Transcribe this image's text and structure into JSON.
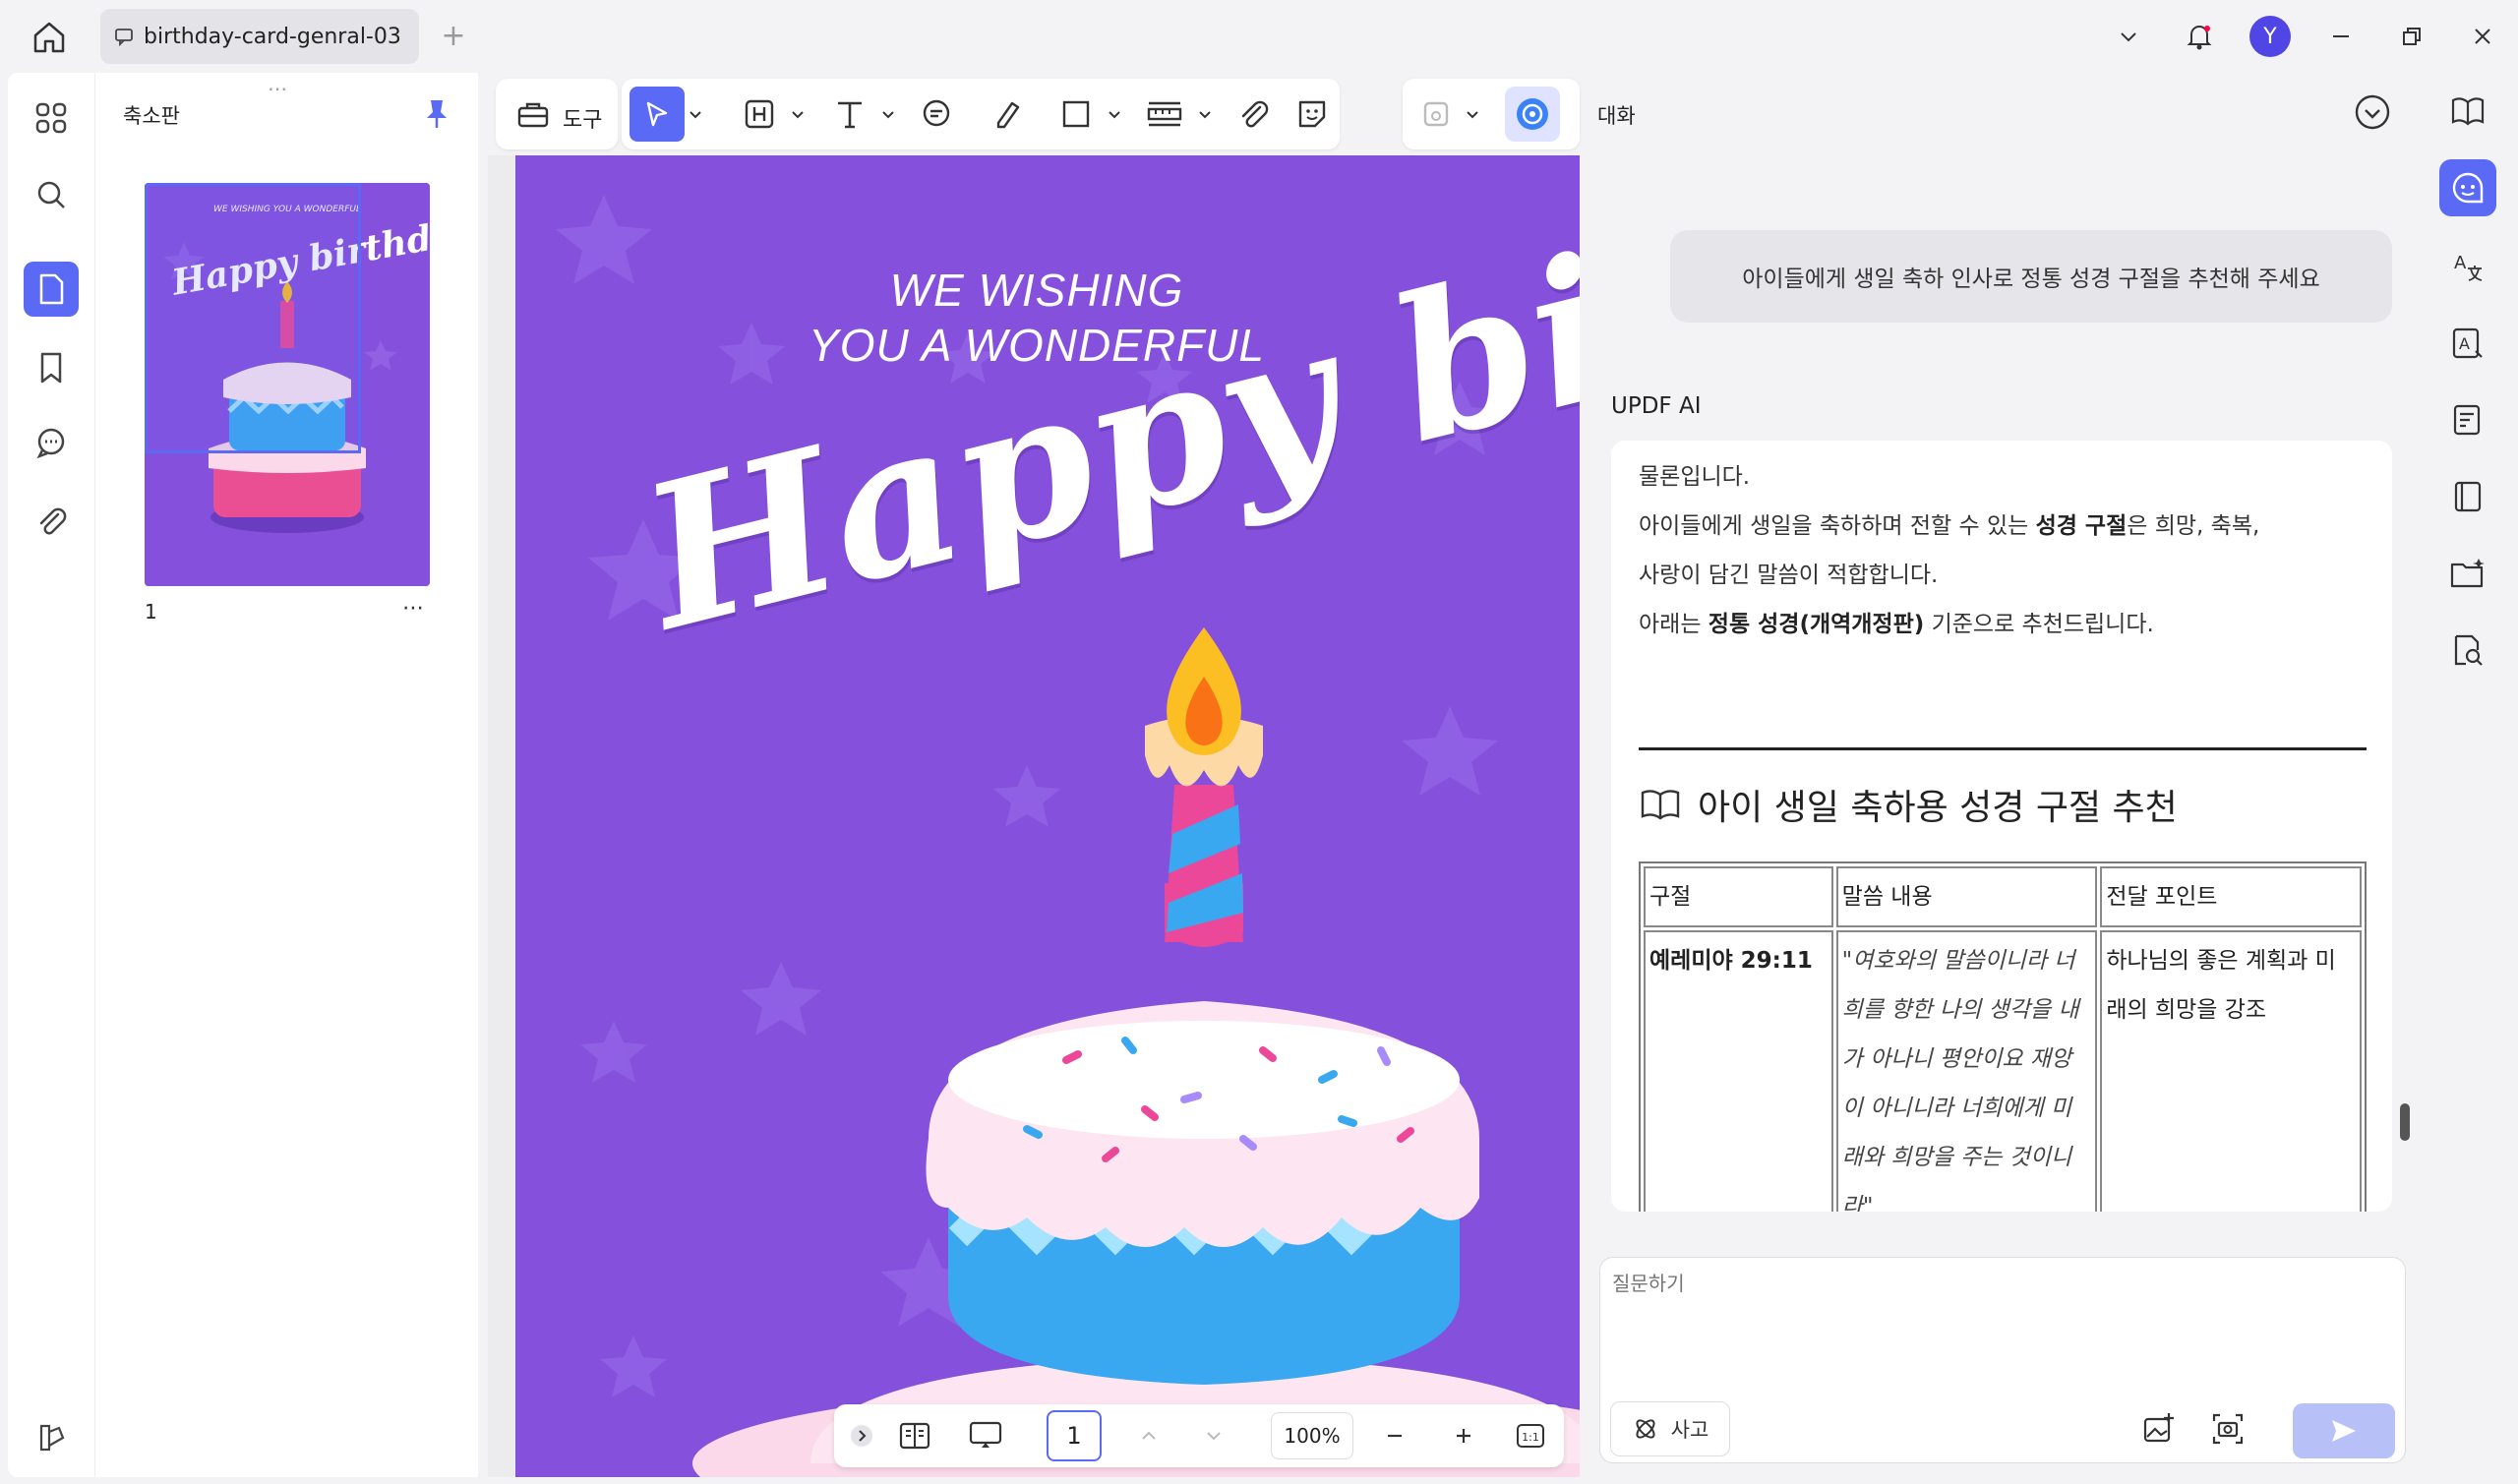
{
  "tab": {
    "title": "birthday-card-genral-03"
  },
  "titlebar": {
    "avatar_letter": "Y"
  },
  "thumbnail_panel": {
    "title": "축소판",
    "page_label": "1",
    "thumb_top_text": "WE WISHING YOU A WONDERFUL",
    "thumb_script": "Happy birthday"
  },
  "toolbar": {
    "tools_label": "도구"
  },
  "document": {
    "card_line1": "WE WISHING",
    "card_line2": "YOU A WONDERFUL",
    "card_script": "Happy birthday"
  },
  "page_nav": {
    "current_page": "1",
    "zoom": "100%"
  },
  "chat": {
    "title": "대화",
    "user_message": "아이들에게 생일 축하 인사로 정통 성경 구절을 추천해 주세요",
    "ai_name": "UPDF AI",
    "ai_line1": "물론입니다.",
    "ai_line2_a": "아이들에게 생일을 축하하며 전할 수 있는 ",
    "ai_line2_b": "성경 구절",
    "ai_line2_c": "은 희망, 축복,",
    "ai_line3": "사랑이 담긴 말씀이 적합합니다.",
    "ai_line4_a": "아래는 ",
    "ai_line4_b": "정통 성경(개역개정판)",
    "ai_line4_c": " 기준으로 추천드립니다.",
    "section_title": "아이 생일 축하용 성경 구절 추천",
    "table": {
      "headers": [
        "구절",
        "말씀 내용",
        "전달 포인트"
      ],
      "rows": [
        {
          "ref": "예레미야 29:11",
          "quote": "\"여호와의 말씀이니라 너희를 향한 나의 생각을 내가 아나니 평안이요 재앙이 아니니라 너희에게 미래와 희망을 주는 것이니라\"",
          "point": "하나님의 좋은 계획과 미래의 희망을 강조"
        }
      ]
    },
    "input_placeholder": "질문하기",
    "think_label": "사고"
  },
  "colors": {
    "accent": "#5b6af5",
    "card_bg": "#8450dc",
    "send_disabled": "#b8c0f8"
  }
}
